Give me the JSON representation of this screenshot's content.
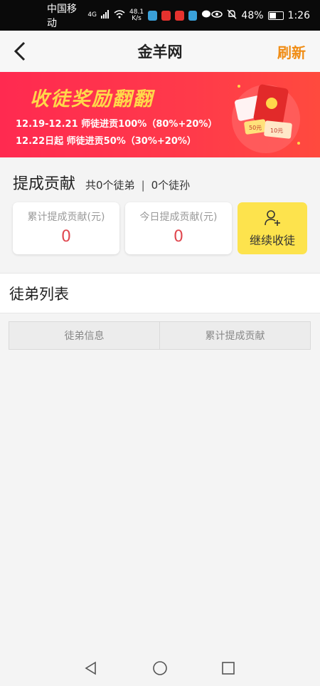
{
  "status_bar": {
    "carrier": "中国移动",
    "network": "4G",
    "speed_value": "48.1",
    "speed_unit": "K/s",
    "battery": "48%",
    "time": "1:26"
  },
  "header": {
    "title": "金羊网",
    "refresh_label": "刷新"
  },
  "banner": {
    "headline": "收徒奖励翻翻",
    "line1": "12.19-12.21  师徒进贡100%（80%+20%）",
    "line2": "12.22日起  师徒进贡50%（30%+20%）",
    "envelope_tag1": "50元",
    "envelope_tag2": "10元"
  },
  "summary": {
    "title": "提成贡献",
    "apprentices": "共0个徒弟",
    "grand_apprentices": "0个徒孙",
    "total_label": "累计提成贡献(元)",
    "total_value": "0",
    "today_label": "今日提成贡献(元)",
    "today_value": "0",
    "invite_label": "继续收徒"
  },
  "list": {
    "title": "徒弟列表",
    "columns": [
      "徒弟信息",
      "累计提成贡献"
    ]
  },
  "colors": {
    "accent_orange": "#f08c14",
    "banner_red": "#ff2a50",
    "value_red": "#e0474f",
    "invite_yellow": "#fde34d"
  }
}
